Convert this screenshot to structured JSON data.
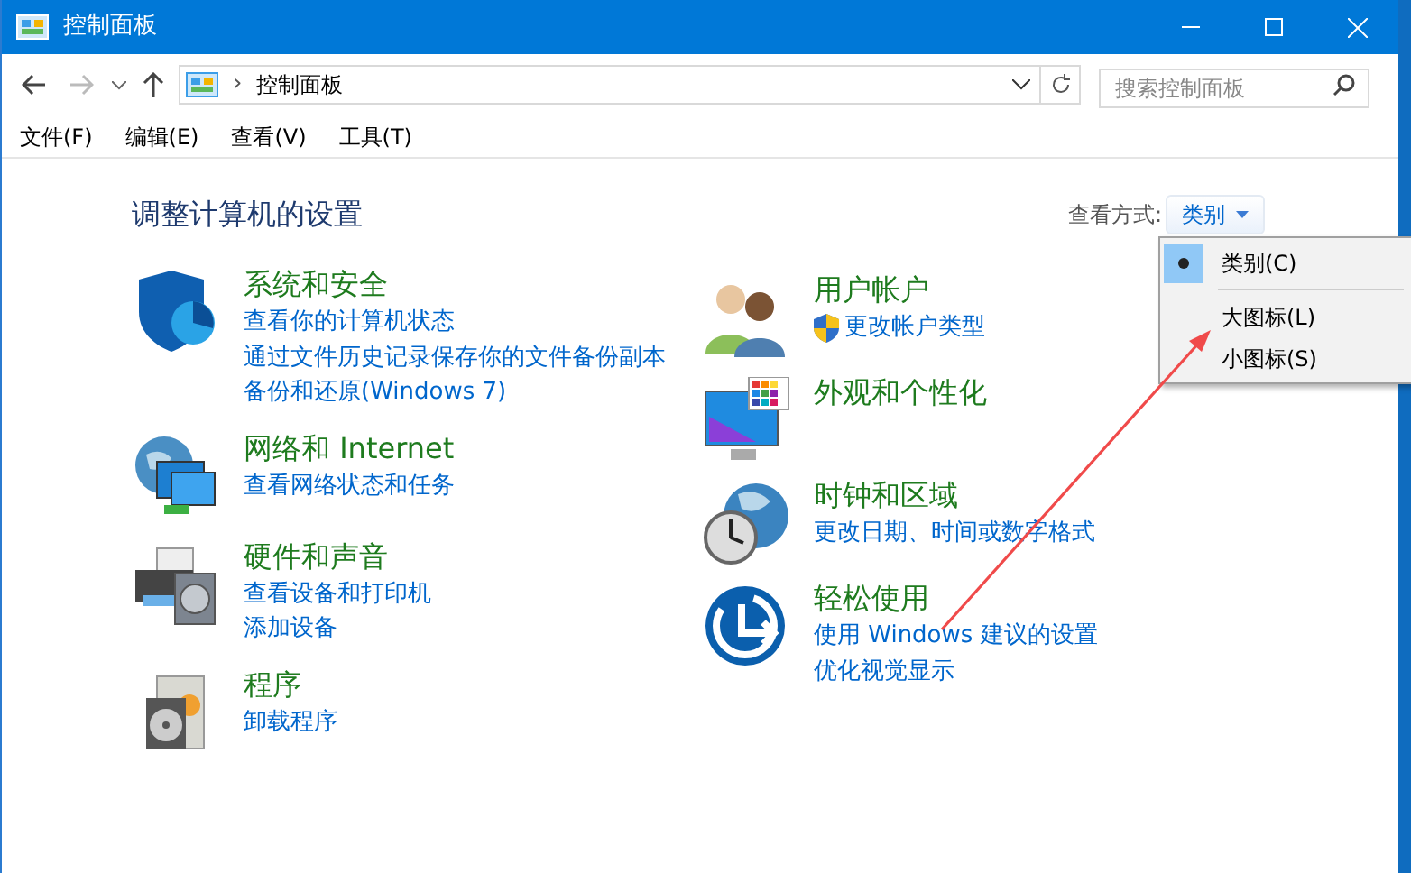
{
  "window": {
    "title": "控制面板"
  },
  "address": {
    "path": "控制面板",
    "separator": "›"
  },
  "search": {
    "placeholder": "搜索控制面板"
  },
  "menu": [
    "文件(F)",
    "编辑(E)",
    "查看(V)",
    "工具(T)"
  ],
  "heading": "调整计算机的设置",
  "view_by": {
    "label": "查看方式:",
    "value": "类别",
    "options": [
      {
        "label": "类别(C)",
        "selected": true
      },
      {
        "label": "大图标(L)",
        "selected": false
      },
      {
        "label": "小图标(S)",
        "selected": false
      }
    ]
  },
  "columns": [
    [
      {
        "kind": "security",
        "title": "系统和安全",
        "links": [
          {
            "text": "查看你的计算机状态",
            "shield": false
          },
          {
            "text": "通过文件历史记录保存你的文件备份副本",
            "shield": false
          },
          {
            "text": "备份和还原(Windows 7)",
            "shield": false
          }
        ]
      },
      {
        "kind": "network",
        "title": "网络和 Internet",
        "links": [
          {
            "text": "查看网络状态和任务",
            "shield": false
          }
        ]
      },
      {
        "kind": "hardware",
        "title": "硬件和声音",
        "links": [
          {
            "text": "查看设备和打印机",
            "shield": false
          },
          {
            "text": "添加设备",
            "shield": false
          }
        ]
      },
      {
        "kind": "programs",
        "title": "程序",
        "links": [
          {
            "text": "卸载程序",
            "shield": false
          }
        ]
      }
    ],
    [
      {
        "kind": "users",
        "title": "用户帐户",
        "links": [
          {
            "text": "更改帐户类型",
            "shield": true
          }
        ]
      },
      {
        "kind": "appearance",
        "title": "外观和个性化"
      },
      {
        "kind": "clock",
        "title": "时钟和区域",
        "links": [
          {
            "text": "更改日期、时间或数字格式",
            "shield": false
          }
        ]
      },
      {
        "kind": "ease",
        "title": "轻松使用",
        "links": [
          {
            "text": "使用 Windows 建议的设置",
            "shield": false
          },
          {
            "text": "优化视觉显示",
            "shield": false
          }
        ]
      }
    ]
  ]
}
